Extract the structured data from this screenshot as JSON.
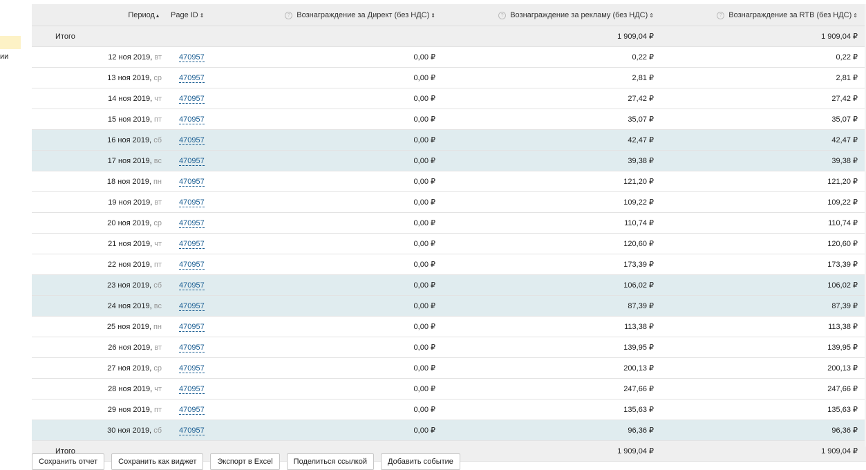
{
  "sidebar": {
    "cut_text": "ии"
  },
  "table": {
    "headers": {
      "period": "Период",
      "period_sort": "▴",
      "page_id": "Page ID",
      "page_id_sort": "⇕",
      "direct": "Вознаграждение за Директ (без НДС)",
      "direct_sort": "⇕",
      "ads": "Вознаграждение за рекламу (без НДС)",
      "ads_sort": "⇕",
      "rtb": "Вознаграждение за RTB (без НДС)",
      "rtb_sort": "⇕",
      "help_icon": "?"
    },
    "total_top": {
      "label": "Итого",
      "direct": "",
      "ads": "1 909,04 ₽",
      "rtb": "1 909,04 ₽"
    },
    "rows": [
      {
        "date": "12 ноя 2019,",
        "dow": "вт",
        "page_id": "470957",
        "direct": "0,00 ₽",
        "ads": "0,22 ₽",
        "rtb": "0,22 ₽",
        "weekend": false
      },
      {
        "date": "13 ноя 2019,",
        "dow": "ср",
        "page_id": "470957",
        "direct": "0,00 ₽",
        "ads": "2,81 ₽",
        "rtb": "2,81 ₽",
        "weekend": false
      },
      {
        "date": "14 ноя 2019,",
        "dow": "чт",
        "page_id": "470957",
        "direct": "0,00 ₽",
        "ads": "27,42 ₽",
        "rtb": "27,42 ₽",
        "weekend": false
      },
      {
        "date": "15 ноя 2019,",
        "dow": "пт",
        "page_id": "470957",
        "direct": "0,00 ₽",
        "ads": "35,07 ₽",
        "rtb": "35,07 ₽",
        "weekend": false
      },
      {
        "date": "16 ноя 2019,",
        "dow": "сб",
        "page_id": "470957",
        "direct": "0,00 ₽",
        "ads": "42,47 ₽",
        "rtb": "42,47 ₽",
        "weekend": true
      },
      {
        "date": "17 ноя 2019,",
        "dow": "вс",
        "page_id": "470957",
        "direct": "0,00 ₽",
        "ads": "39,38 ₽",
        "rtb": "39,38 ₽",
        "weekend": true
      },
      {
        "date": "18 ноя 2019,",
        "dow": "пн",
        "page_id": "470957",
        "direct": "0,00 ₽",
        "ads": "121,20 ₽",
        "rtb": "121,20 ₽",
        "weekend": false
      },
      {
        "date": "19 ноя 2019,",
        "dow": "вт",
        "page_id": "470957",
        "direct": "0,00 ₽",
        "ads": "109,22 ₽",
        "rtb": "109,22 ₽",
        "weekend": false
      },
      {
        "date": "20 ноя 2019,",
        "dow": "ср",
        "page_id": "470957",
        "direct": "0,00 ₽",
        "ads": "110,74 ₽",
        "rtb": "110,74 ₽",
        "weekend": false
      },
      {
        "date": "21 ноя 2019,",
        "dow": "чт",
        "page_id": "470957",
        "direct": "0,00 ₽",
        "ads": "120,60 ₽",
        "rtb": "120,60 ₽",
        "weekend": false
      },
      {
        "date": "22 ноя 2019,",
        "dow": "пт",
        "page_id": "470957",
        "direct": "0,00 ₽",
        "ads": "173,39 ₽",
        "rtb": "173,39 ₽",
        "weekend": false
      },
      {
        "date": "23 ноя 2019,",
        "dow": "сб",
        "page_id": "470957",
        "direct": "0,00 ₽",
        "ads": "106,02 ₽",
        "rtb": "106,02 ₽",
        "weekend": true
      },
      {
        "date": "24 ноя 2019,",
        "dow": "вс",
        "page_id": "470957",
        "direct": "0,00 ₽",
        "ads": "87,39 ₽",
        "rtb": "87,39 ₽",
        "weekend": true
      },
      {
        "date": "25 ноя 2019,",
        "dow": "пн",
        "page_id": "470957",
        "direct": "0,00 ₽",
        "ads": "113,38 ₽",
        "rtb": "113,38 ₽",
        "weekend": false
      },
      {
        "date": "26 ноя 2019,",
        "dow": "вт",
        "page_id": "470957",
        "direct": "0,00 ₽",
        "ads": "139,95 ₽",
        "rtb": "139,95 ₽",
        "weekend": false
      },
      {
        "date": "27 ноя 2019,",
        "dow": "ср",
        "page_id": "470957",
        "direct": "0,00 ₽",
        "ads": "200,13 ₽",
        "rtb": "200,13 ₽",
        "weekend": false
      },
      {
        "date": "28 ноя 2019,",
        "dow": "чт",
        "page_id": "470957",
        "direct": "0,00 ₽",
        "ads": "247,66 ₽",
        "rtb": "247,66 ₽",
        "weekend": false
      },
      {
        "date": "29 ноя 2019,",
        "dow": "пт",
        "page_id": "470957",
        "direct": "0,00 ₽",
        "ads": "135,63 ₽",
        "rtb": "135,63 ₽",
        "weekend": false
      },
      {
        "date": "30 ноя 2019,",
        "dow": "сб",
        "page_id": "470957",
        "direct": "0,00 ₽",
        "ads": "96,36 ₽",
        "rtb": "96,36 ₽",
        "weekend": true
      }
    ],
    "total_bottom": {
      "label": "Итого",
      "direct": "",
      "ads": "1 909,04 ₽",
      "rtb": "1 909,04 ₽"
    }
  },
  "actions": {
    "save_report": "Сохранить отчет",
    "save_widget": "Сохранить как виджет",
    "export_excel": "Экспорт в Excel",
    "share_link": "Поделиться ссылкой",
    "add_event": "Добавить событие"
  },
  "colors": {
    "weekend_row": "#e0ecef",
    "header_bg": "#eeeeee",
    "link": "#1a5e93",
    "sidebar_highlight": "#fdf2c6"
  }
}
